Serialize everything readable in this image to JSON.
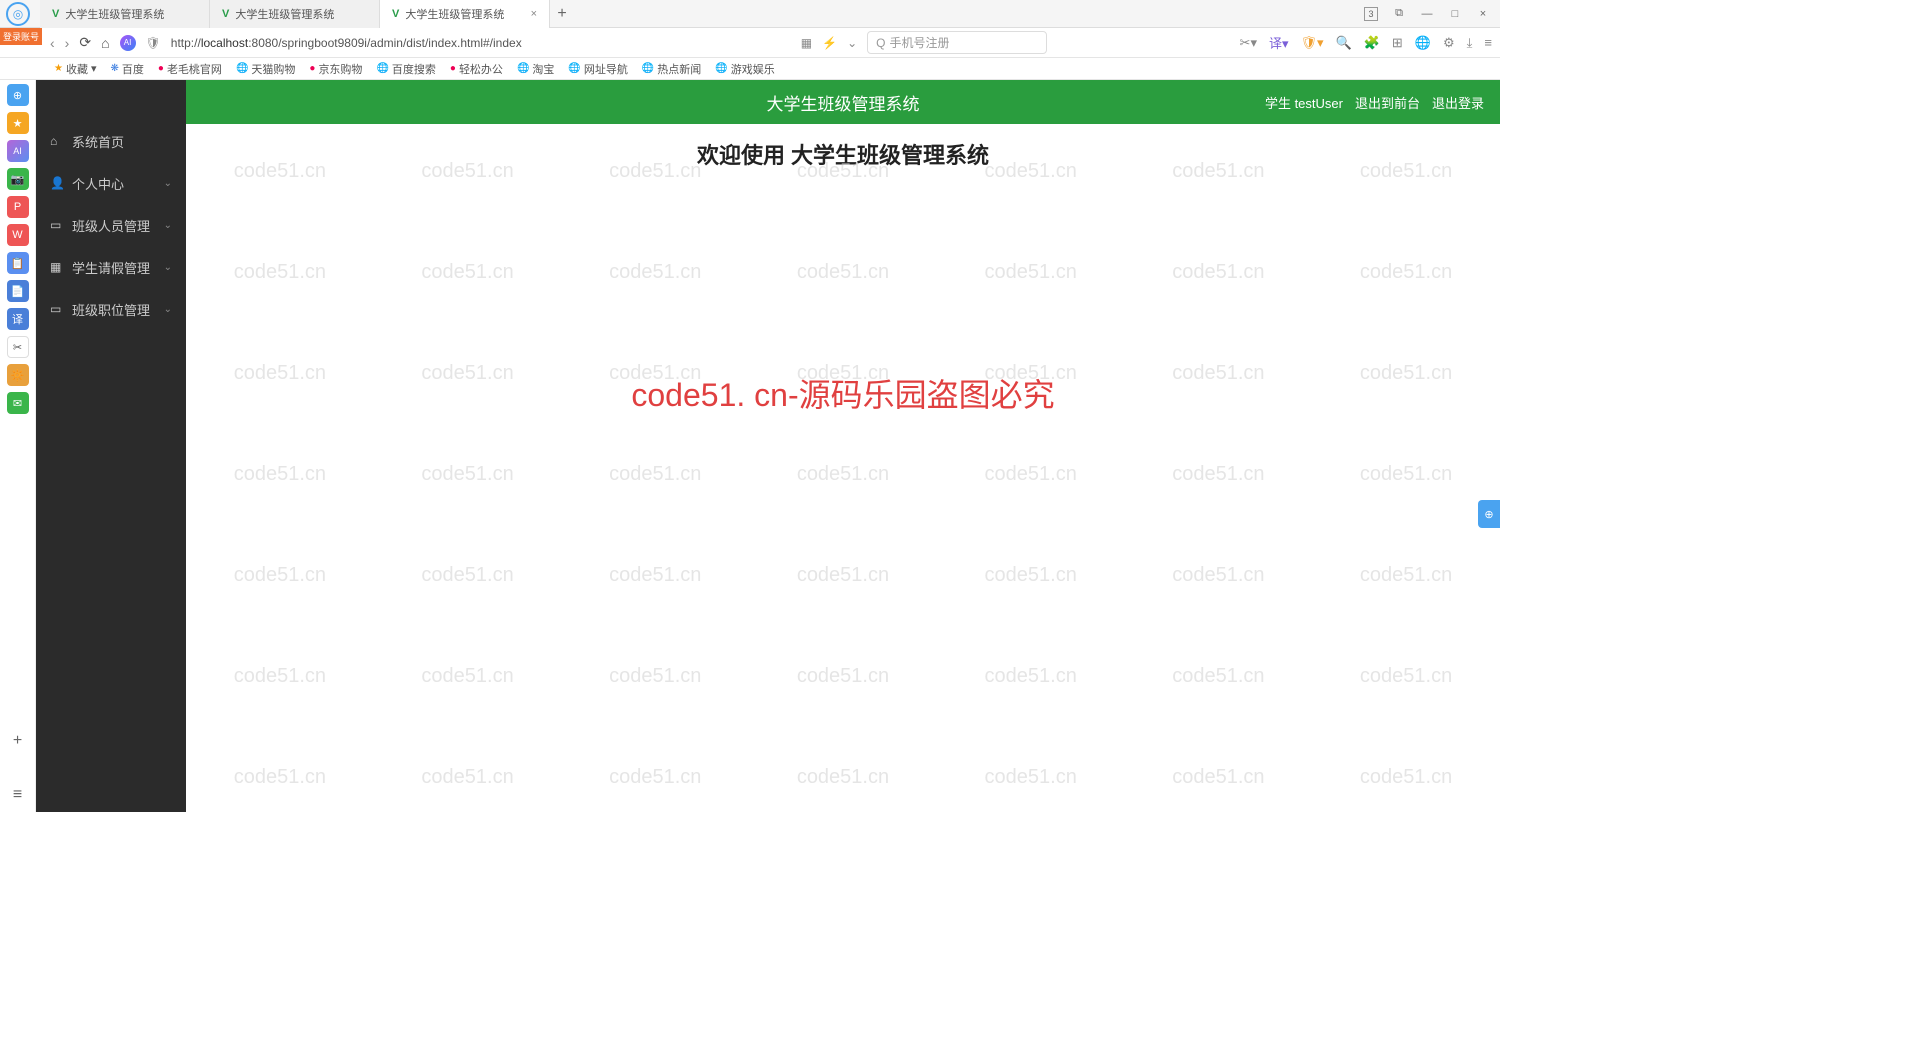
{
  "browser": {
    "tabs": [
      {
        "title": "大学生班级管理系统"
      },
      {
        "title": "大学生班级管理系统"
      },
      {
        "title": "大学生班级管理系统"
      }
    ],
    "url_prefix": "http://",
    "url_host": "localhost",
    "url_path": ":8080/springboot9809i/admin/dist/index.html#/index",
    "search_placeholder": "手机号注册",
    "win_count": "3",
    "login_badge": "登录账号"
  },
  "bookmarks": {
    "fav_label": "收藏",
    "items": [
      "百度",
      "老毛桃官网",
      "天猫购物",
      "京东购物",
      "百度搜索",
      "轻松办公",
      "淘宝",
      "网址导航",
      "热点新闻",
      "游戏娱乐"
    ]
  },
  "rail_icons": [
    {
      "bg": "#4aa3f0",
      "txt": "⊕"
    },
    {
      "bg": "#f5a623",
      "txt": "★"
    },
    {
      "bg": "#b565d8",
      "txt": "AI"
    },
    {
      "bg": "#3ab54a",
      "txt": "📷"
    },
    {
      "bg": "#e55",
      "txt": "P"
    },
    {
      "bg": "#e55",
      "txt": "W"
    },
    {
      "bg": "#5a8ff0",
      "txt": "📋"
    },
    {
      "bg": "#4a7fd8",
      "txt": "📄"
    },
    {
      "bg": "#4a7fd8",
      "txt": "译"
    },
    {
      "bg": "#fff",
      "txt": "✂",
      "fg": "#555"
    },
    {
      "bg": "#e8a03c",
      "txt": "🔆"
    },
    {
      "bg": "#3ab54a",
      "txt": "✉"
    }
  ],
  "sidebar": [
    {
      "icon": "⌂",
      "label": "系统首页",
      "expand": false
    },
    {
      "icon": "👤",
      "label": "个人中心",
      "expand": true
    },
    {
      "icon": "▭",
      "label": "班级人员管理",
      "expand": true
    },
    {
      "icon": "▦",
      "label": "学生请假管理",
      "expand": true
    },
    {
      "icon": "▭",
      "label": "班级职位管理",
      "expand": true
    }
  ],
  "app": {
    "title": "大学生班级管理系统",
    "user_label": "学生 testUser",
    "logout_front": "退出到前台",
    "logout": "退出登录",
    "welcome": "欢迎使用 大学生班级管理系统"
  },
  "watermark": {
    "text": "code51.cn",
    "center": "code51. cn-源码乐园盗图必究"
  }
}
